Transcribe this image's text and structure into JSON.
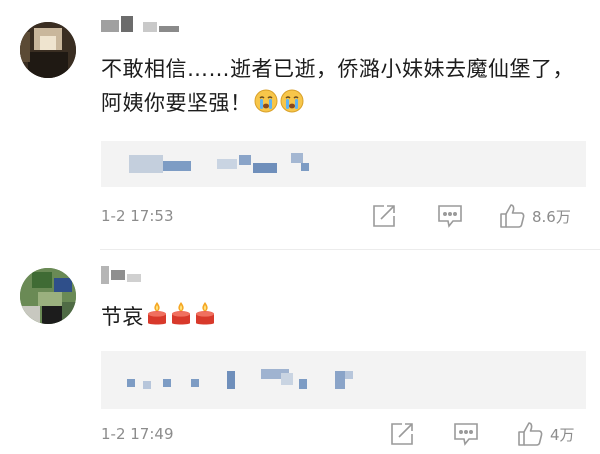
{
  "comments": [
    {
      "text": "不敢相信……逝者已逝，侨潞小妹妹去魔仙堡了，阿姨你要坚强！",
      "emojis": [
        "crying-face-icon",
        "crying-face-icon"
      ],
      "time": "1-2 17:53",
      "likes": "8.6万"
    },
    {
      "text": "节哀",
      "emojis": [
        "candle-icon",
        "candle-icon",
        "candle-icon"
      ],
      "time": "1-2 17:49",
      "likes": "4万"
    }
  ],
  "colors": {
    "meta_gray": "#8c8c8c",
    "reply_bg": "#f3f3f3",
    "blur_blue": "#7d9cc4"
  }
}
